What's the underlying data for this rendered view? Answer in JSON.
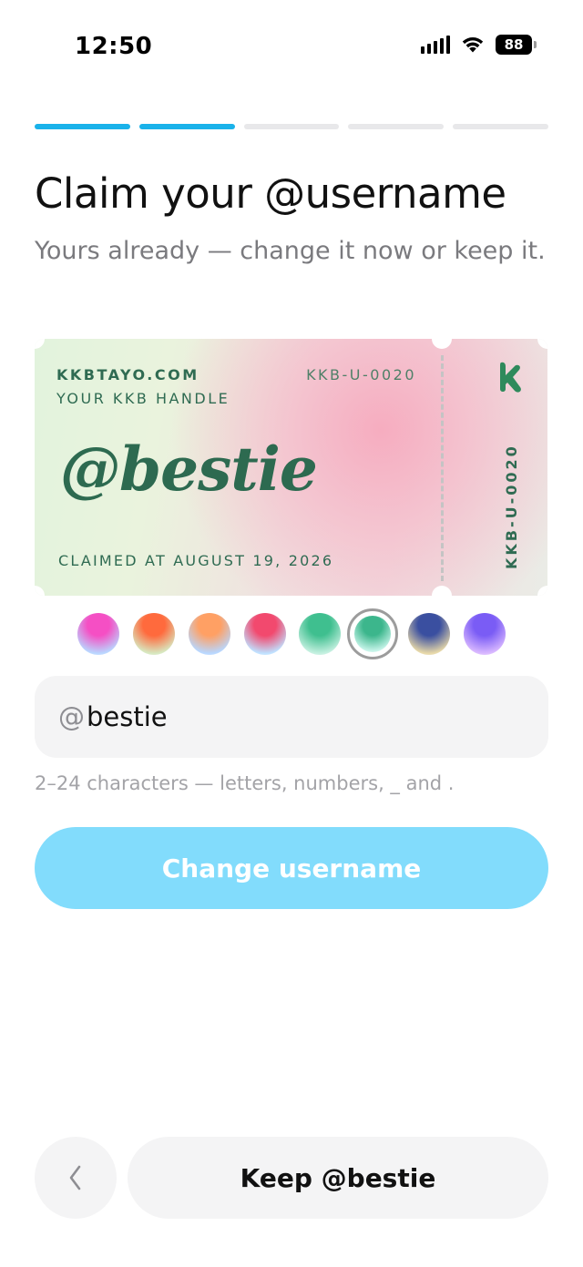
{
  "status_bar": {
    "time": "12:50",
    "battery": "88"
  },
  "onboarding": {
    "steps_total": 5,
    "steps_completed": 2
  },
  "header": {
    "title": "Claim your @username",
    "subtitle": "Yours already — change it now or keep it."
  },
  "ticket": {
    "site": "KKBTAYO.COM",
    "handle_label": "YOUR KKB HANDLE",
    "code": "KKB-U-0020",
    "username": "@bestie",
    "claimed": "CLAIMED AT AUGUST 19, 2026",
    "vertical_code": "KKB-U-0020"
  },
  "themes": {
    "options": [
      "pink-blue",
      "orange-cream",
      "peach-blue",
      "rose-blue",
      "mint-green",
      "seafoam",
      "navy-sand",
      "violet"
    ],
    "selected_index": 5,
    "colors": [
      [
        "#f54fc4",
        "#b9d6ff"
      ],
      [
        "#ff6a3d",
        "#d7e8c0"
      ],
      [
        "#ffa064",
        "#b8d7ff"
      ],
      [
        "#f2496e",
        "#bfe1ff"
      ],
      [
        "#3fbf8f",
        "#c4f0e0"
      ],
      [
        "#3cb68c",
        "#c6f4e9"
      ],
      [
        "#3a4fa0",
        "#e7d8a8"
      ],
      [
        "#7a5cf5",
        "#d9b8ff"
      ]
    ]
  },
  "username_field": {
    "prefix": "@",
    "value": "bestie"
  },
  "hint": "2–24 characters — letters, numbers, _ and .",
  "buttons": {
    "change": "Change username",
    "keep": "Keep @bestie"
  }
}
